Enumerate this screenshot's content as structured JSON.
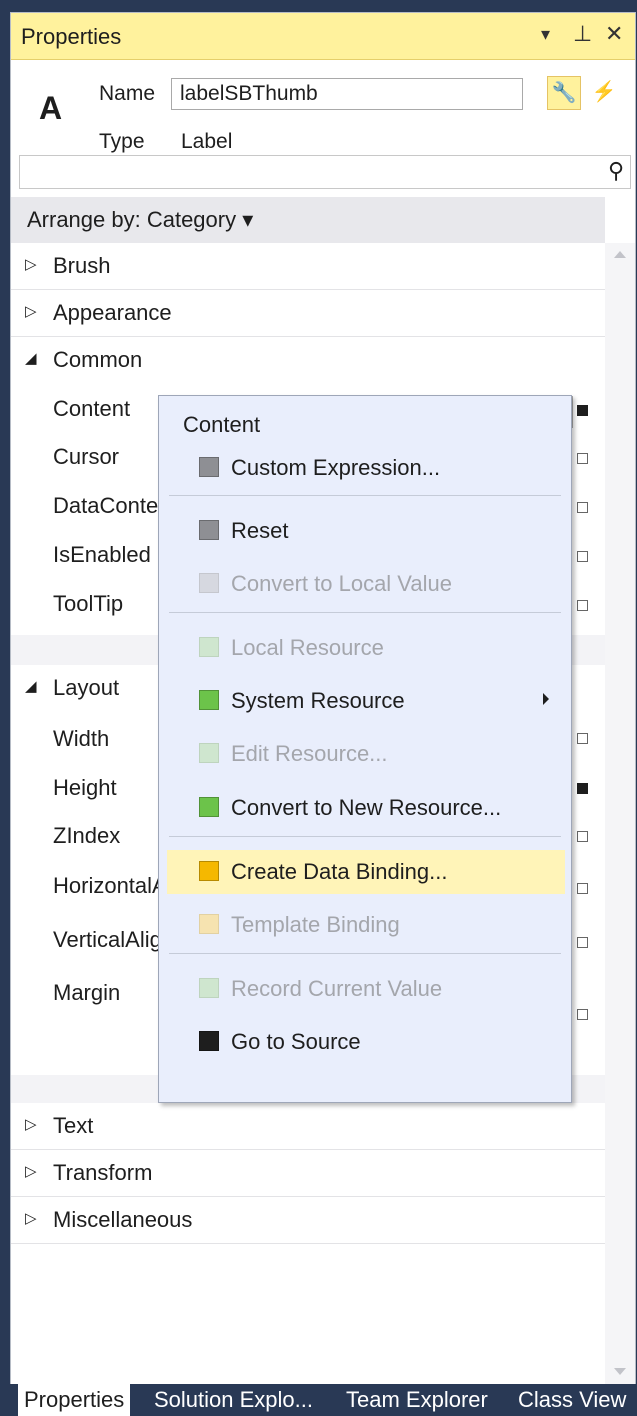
{
  "window": {
    "title": "Properties",
    "controls": {
      "dropdown": "▾",
      "pin": "⊥",
      "close": "✕"
    }
  },
  "header": {
    "icon_letter": "A",
    "name_label": "Name",
    "name_value": "labelSBThumb",
    "type_label": "Type",
    "type_value": "Label",
    "properties_button": "🔧",
    "events_button": "⚡"
  },
  "search": {
    "placeholder": "",
    "icon": "search-icon"
  },
  "arrange": {
    "label": "Arrange by: Category ▾"
  },
  "categories": {
    "brush": {
      "arrow": "▷",
      "label": "Brush"
    },
    "appearance": {
      "arrow": "▷",
      "label": "Appearance"
    },
    "common": {
      "arrow": "◢",
      "label": "Common"
    },
    "layout": {
      "arrow": "◢",
      "label": "Layout"
    },
    "text": {
      "arrow": "▷",
      "label": "Text"
    },
    "transform": {
      "arrow": "▷",
      "label": "Transform"
    },
    "miscellaneous": {
      "arrow": "▷",
      "label": "Miscellaneous"
    }
  },
  "common_props": [
    "Content",
    "Cursor",
    "DataContext",
    "IsEnabled",
    "ToolTip"
  ],
  "layout_props": [
    "Width",
    "Height",
    "ZIndex",
    "HorizontalAlignment",
    "VerticalAlignment",
    "Margin"
  ],
  "context_menu": {
    "header": "Content",
    "items": [
      {
        "label": "Custom Expression...",
        "color": "#8e8f94",
        "enabled": true
      },
      {
        "label": "Reset",
        "color": "#8e8f94",
        "enabled": true
      },
      {
        "label": "Convert to Local Value",
        "color": "#d6d8e0",
        "enabled": false
      },
      {
        "label": "Local Resource",
        "color": "#cfe6cf",
        "enabled": false
      },
      {
        "label": "System Resource",
        "color": "#6cc34a",
        "enabled": true,
        "submenu": true
      },
      {
        "label": "Edit Resource...",
        "color": "#cfe6cf",
        "enabled": false
      },
      {
        "label": "Convert to New Resource...",
        "color": "#6cc34a",
        "enabled": true
      },
      {
        "label": "Create Data Binding...",
        "color": "#f5b800",
        "enabled": true,
        "highlighted": true
      },
      {
        "label": "Template Binding",
        "color": "#f6e3b0",
        "enabled": false
      },
      {
        "label": "Record Current Value",
        "color": "#cfe6cf",
        "enabled": false
      },
      {
        "label": "Go to Source",
        "color": "#1e1e1e",
        "enabled": true
      }
    ]
  },
  "bottom_tabs": [
    "Properties",
    "Solution Explo...",
    "Team Explorer",
    "Class View"
  ]
}
